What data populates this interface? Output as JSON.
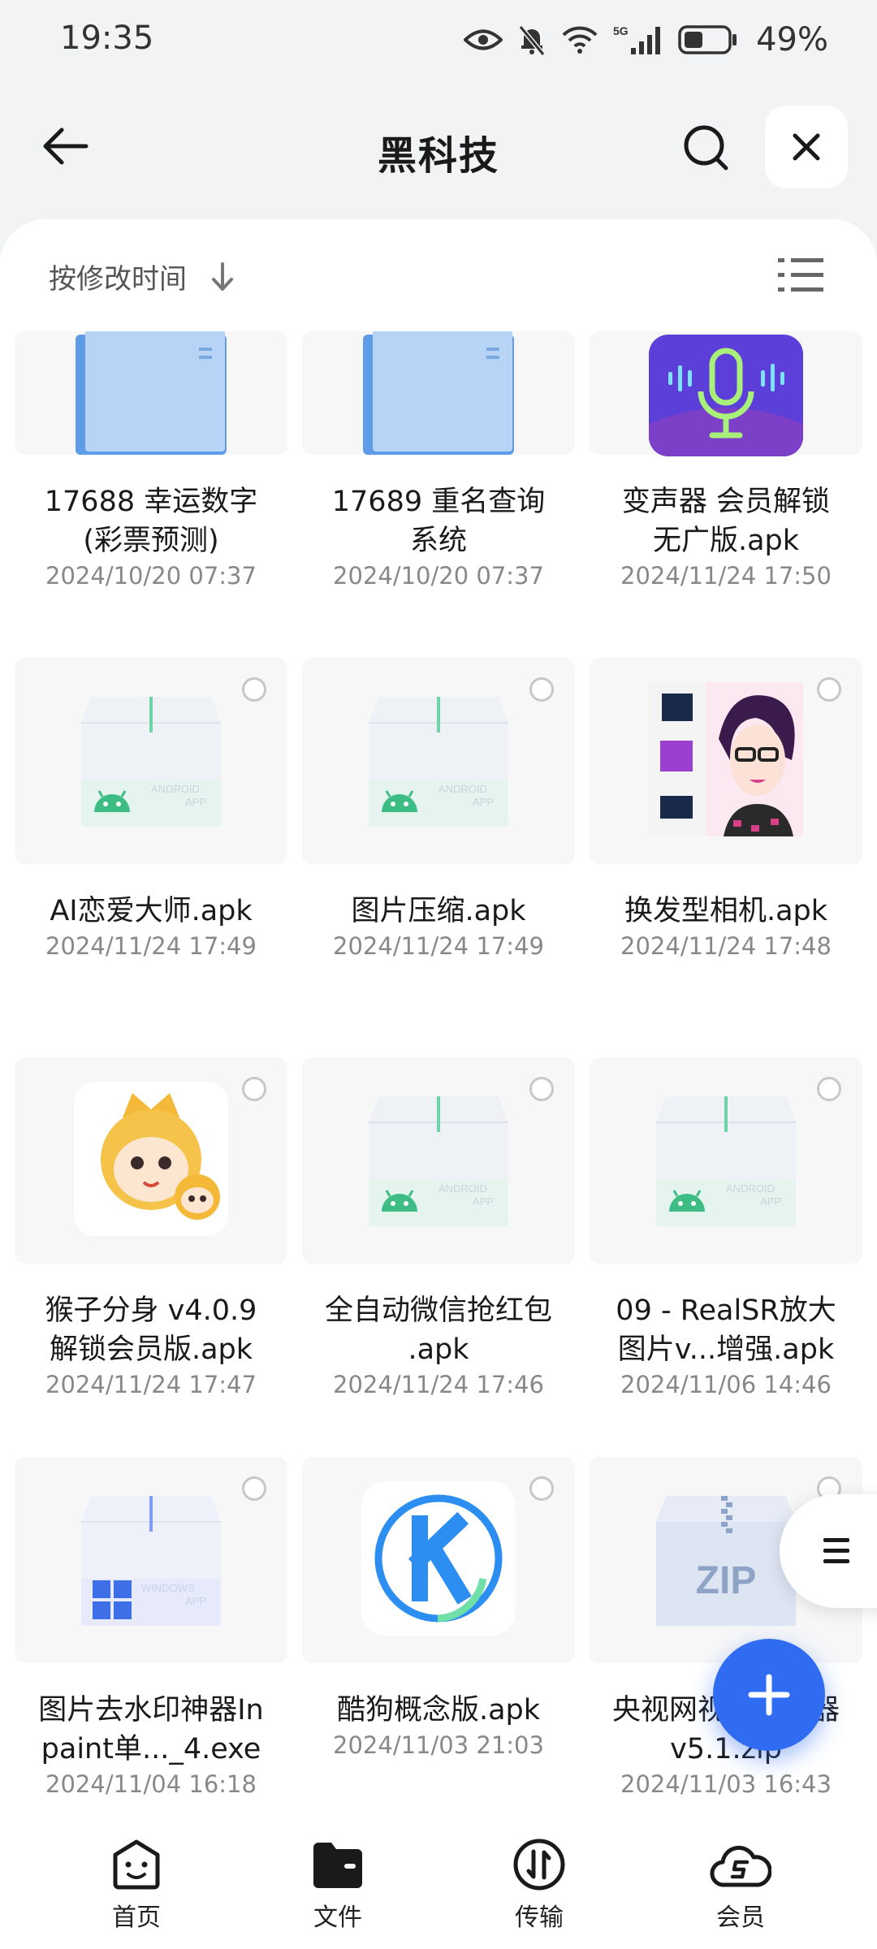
{
  "status_bar": {
    "time": "19:35",
    "battery": "49%",
    "network": "5G"
  },
  "header": {
    "title": "黑科技"
  },
  "sort": {
    "label": "按修改时间"
  },
  "files": [
    {
      "name": "17688 幸运数字\n(彩票预测)",
      "date": "2024/10/20 07:37",
      "icon": "folder-icon"
    },
    {
      "name": "17689 重名查询\n系统",
      "date": "2024/10/20 07:37",
      "icon": "folder-icon"
    },
    {
      "name": "变声器 会员解锁\n无广版.apk",
      "date": "2024/11/24 17:50",
      "icon": "voice-changer-app-icon"
    },
    {
      "name": "AI恋爱大师.apk",
      "date": "2024/11/24 17:49",
      "icon": "android-apk-icon"
    },
    {
      "name": "图片压缩.apk",
      "date": "2024/11/24 17:49",
      "icon": "android-apk-icon"
    },
    {
      "name": "换发型相机.apk",
      "date": "2024/11/24 17:48",
      "icon": "hairstyle-camera-app-icon"
    },
    {
      "name": "猴子分身 v4.0.9\n解锁会员版.apk",
      "date": "2024/11/24 17:47",
      "icon": "monkey-clone-app-icon"
    },
    {
      "name": "全自动微信抢红包\n.apk",
      "date": "2024/11/24 17:46",
      "icon": "android-apk-icon"
    },
    {
      "name": "09 - RealSR放大\n图片v...增强.apk",
      "date": "2024/11/06 14:46",
      "icon": "android-apk-icon"
    },
    {
      "name": "图片去水印神器In\npaint单..._4.exe",
      "date": "2024/11/04 16:18",
      "icon": "windows-exe-icon"
    },
    {
      "name": "酷狗概念版.apk",
      "date": "2024/11/03 21:03",
      "icon": "kugou-app-icon"
    },
    {
      "name": "央视网视频播放器\nv5.1.zip",
      "date": "2024/11/03 16:43",
      "icon": "zip-archive-icon"
    }
  ],
  "bottom_nav": [
    {
      "label": "首页",
      "icon": "home-face-icon"
    },
    {
      "label": "文件",
      "icon": "folder-filled-icon"
    },
    {
      "label": "传输",
      "icon": "transfer-icon"
    },
    {
      "label": "会员",
      "icon": "vip-cloud-icon"
    }
  ],
  "colors": {
    "accent": "#2f6cf2",
    "background": "#f2f3f5"
  }
}
